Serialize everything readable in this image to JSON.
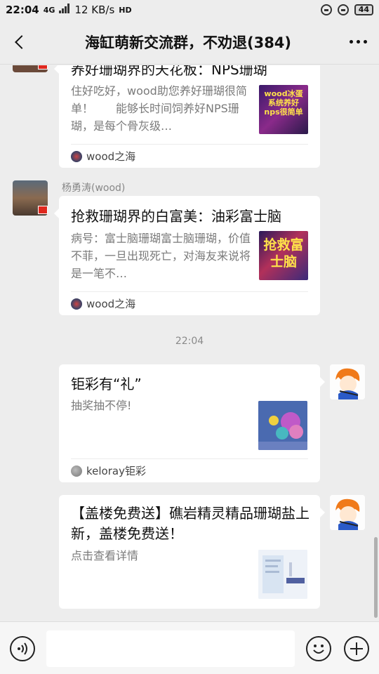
{
  "status_bar": {
    "time": "22:04",
    "network": "4G",
    "speed": "12 KB/s",
    "hd": "HD",
    "battery": "44"
  },
  "header": {
    "title": "海缸萌新交流群，不劝退(384)"
  },
  "messages": [
    {
      "title": "养好珊瑚界的天花板：NPS珊瑚",
      "desc": "住好吃好，wood助您养好珊瑚很简单！　　能够长时间饲养好NPS珊瑚，是每个骨灰级…",
      "thumb_text": "wood冰蛋系统养好nps很简单",
      "source": "wood之海"
    },
    {
      "sender": "杨勇涛(wood)",
      "title": "抢救珊瑚界的白富美：油彩富士脑",
      "desc": "病号：富士脑珊瑚富士脑珊瑚，价值不菲，一旦出现死亡，对海友来说将是一笔不…",
      "thumb_text": "抢救富士脑",
      "source": "wood之海"
    },
    {
      "timestamp": "22:04"
    },
    {
      "title": "钜彩有“礼”",
      "desc": "抽奖抽不停!",
      "source": "keloray钜彩"
    },
    {
      "title": "【盖楼免费送】礁岩精灵精品珊瑚盐上新，盖楼免费送！",
      "desc": "点击查看详情"
    }
  ],
  "colors": {
    "background": "#ededed",
    "card": "#ffffff",
    "flag": "#e0281e"
  }
}
